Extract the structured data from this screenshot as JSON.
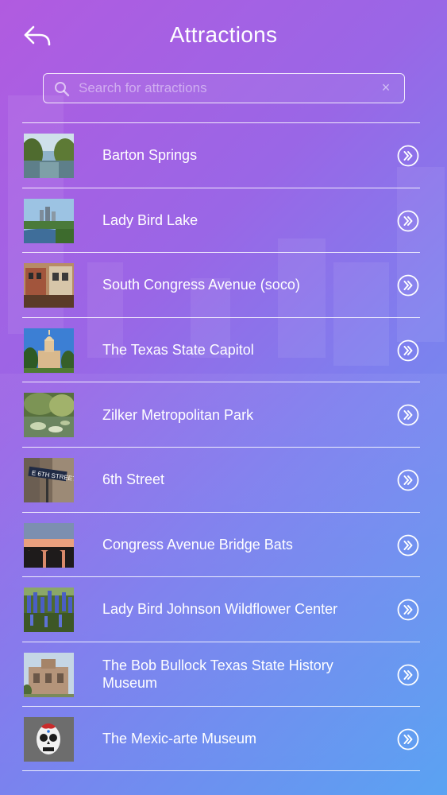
{
  "header": {
    "title": "Attractions",
    "back_icon": "back-arrow-icon"
  },
  "search": {
    "placeholder": "Search for attractions",
    "value": "",
    "clear_icon": "×"
  },
  "attractions": [
    {
      "label": "Barton Springs",
      "thumb": "river-trees"
    },
    {
      "label": "Lady Bird Lake",
      "thumb": "lake-skyline"
    },
    {
      "label": "South Congress Avenue (soco)",
      "thumb": "storefronts"
    },
    {
      "label": "The Texas State Capitol",
      "thumb": "capitol-dome"
    },
    {
      "label": "Zilker Metropolitan Park",
      "thumb": "garden-pond"
    },
    {
      "label": "6th Street",
      "thumb": "street-sign"
    },
    {
      "label": "Congress Avenue Bridge Bats",
      "thumb": "bridge-sunset"
    },
    {
      "label": "Lady Bird Johnson Wildflower Center",
      "thumb": "bluebonnets"
    },
    {
      "label": "The Bob Bullock Texas State History Museum",
      "thumb": "museum-building"
    },
    {
      "label": "The Mexic-arte Museum",
      "thumb": "sugar-skull"
    }
  ],
  "colors": {
    "gradient_start": "#b15be0",
    "gradient_end": "#5aa3f2",
    "line": "#ffffff"
  }
}
